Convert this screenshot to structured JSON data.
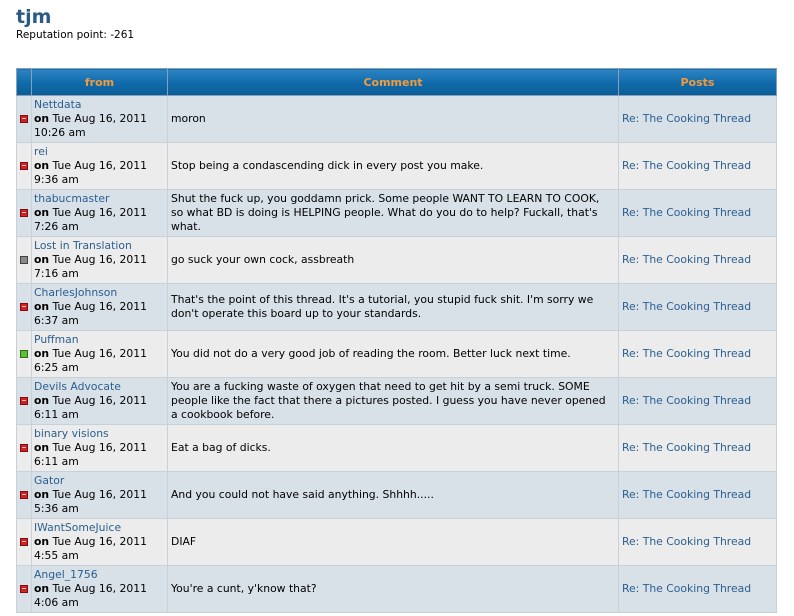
{
  "profile": {
    "username": "tjm",
    "reputation_text": "Reputation point: -261"
  },
  "table": {
    "headers": {
      "from": "from",
      "comment": "Comment",
      "posts": "Posts"
    },
    "rows": [
      {
        "author": "Nettdata",
        "on": "on",
        "date": "Tue Aug 16, 2011",
        "time": "10:26 am",
        "comment": "moron",
        "post": "Re: The Cooking Thread",
        "mark": "red"
      },
      {
        "author": "rei",
        "on": "on",
        "date": "Tue Aug 16, 2011",
        "time": "9:36 am",
        "comment": "Stop being a condascending dick in every post you make.",
        "post": "Re: The Cooking Thread",
        "mark": "red"
      },
      {
        "author": "thabucmaster",
        "on": "on",
        "date": "Tue Aug 16, 2011",
        "time": "7:26 am",
        "comment": "Shut the fuck up, you goddamn prick. Some people WANT TO LEARN TO COOK, so what BD is doing is HELPING people. What do you do to help? Fuckall, that's what.",
        "post": "Re: The Cooking Thread",
        "mark": "red"
      },
      {
        "author": "Lost in Translation",
        "on": "on",
        "date": "Tue Aug 16, 2011",
        "time": "7:16 am",
        "comment": "go suck your own cock, assbreath",
        "post": "Re: The Cooking Thread",
        "mark": "gray"
      },
      {
        "author": "CharlesJohnson",
        "on": "on",
        "date": "Tue Aug 16, 2011",
        "time": "6:37 am",
        "comment": "That's the point of this thread. It's a tutorial, you stupid fuck shit. I'm sorry we don't operate this board up to your standards.",
        "post": "Re: The Cooking Thread",
        "mark": "red"
      },
      {
        "author": "Puffman",
        "on": "on",
        "date": "Tue Aug 16, 2011",
        "time": "6:25 am",
        "comment": "You did not do a very good job of reading the room. Better luck next time.",
        "post": "Re: The Cooking Thread",
        "mark": "green"
      },
      {
        "author": "Devils Advocate",
        "on": "on",
        "date": "Tue Aug 16, 2011",
        "time": "6:11 am",
        "comment": "You are a fucking waste of oxygen that need to get hit by a semi truck. SOME people like the fact that there a pictures posted. I guess you have never opened a cookbook before.",
        "post": "Re: The Cooking Thread",
        "mark": "red"
      },
      {
        "author": "binary visions",
        "on": "on",
        "date": "Tue Aug 16, 2011",
        "time": "6:11 am",
        "comment": "Eat a bag of dicks.",
        "post": "Re: The Cooking Thread",
        "mark": "red"
      },
      {
        "author": "Gator",
        "on": "on",
        "date": "Tue Aug 16, 2011",
        "time": "5:36 am",
        "comment": "And you could not have said anything. Shhhh.....",
        "post": "Re: The Cooking Thread",
        "mark": "red"
      },
      {
        "author": "IWantSomeJuice",
        "on": "on",
        "date": "Tue Aug 16, 2011",
        "time": "4:55 am",
        "comment": "DIAF",
        "post": "Re: The Cooking Thread",
        "mark": "red"
      },
      {
        "author": "Angel_1756",
        "on": "on",
        "date": "Tue Aug 16, 2011",
        "time": "4:06 am",
        "comment": "You're a cunt, y'know that?",
        "post": "Re: The Cooking Thread",
        "mark": "red"
      }
    ]
  },
  "colors": {
    "header_bg": "#0f6aa9",
    "header_text": "#f39a3c",
    "link": "#2a5f8f",
    "row_odd": "#d8e0e8",
    "row_even": "#ececec",
    "mark_red": "#d42020",
    "mark_gray": "#8a8a8a",
    "mark_green": "#5fbf35"
  }
}
